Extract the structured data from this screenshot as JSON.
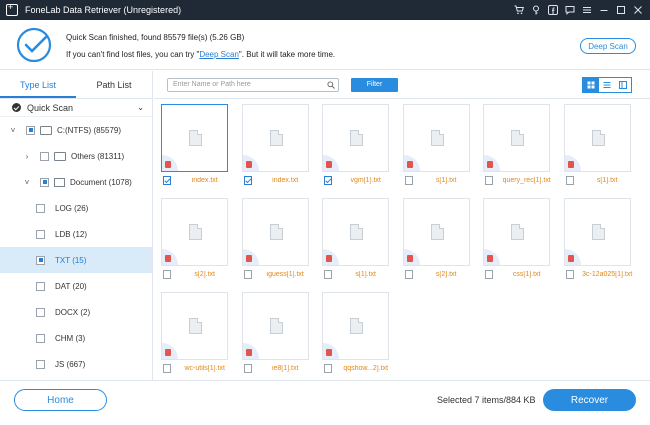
{
  "window": {
    "title": "FoneLab Data Retriever (Unregistered)",
    "icons": [
      "cart-icon",
      "key-icon",
      "facebook-icon",
      "chat-icon",
      "menu-icon",
      "minimize-icon",
      "maximize-icon",
      "close-icon"
    ]
  },
  "status": {
    "line1": "Quick Scan finished, found 85579 file(s) (5.26 GB)",
    "line2_pre": "If you can't find lost files, you can try \"",
    "line2_link": "Deep Scan",
    "line2_post": "\". But it will take more time.",
    "deep_scan_button": "Deep Scan"
  },
  "sidebar": {
    "tabs": [
      "Type List",
      "Path List"
    ],
    "active_tab": "Type List",
    "scan_mode": "Quick Scan",
    "tree": [
      {
        "label": "C:(NTFS) (85579)",
        "level": 0,
        "expander": "expanded",
        "check": "partial",
        "icon": "drive"
      },
      {
        "label": "Others (81311)",
        "level": 1,
        "expander": "collapsed",
        "check": "none",
        "icon": "folder"
      },
      {
        "label": "Document (1078)",
        "level": 1,
        "expander": "expanded",
        "check": "partial",
        "icon": "document"
      },
      {
        "label": "LOG (26)",
        "level": 2,
        "check": "none"
      },
      {
        "label": "LDB (12)",
        "level": 2,
        "check": "none"
      },
      {
        "label": "TXT (15)",
        "level": 2,
        "check": "partial",
        "selected": true
      },
      {
        "label": "DAT (20)",
        "level": 2,
        "check": "none"
      },
      {
        "label": "DOCX (2)",
        "level": 2,
        "check": "none"
      },
      {
        "label": "CHM (3)",
        "level": 2,
        "check": "none"
      },
      {
        "label": "JS (667)",
        "level": 2,
        "check": "none"
      }
    ]
  },
  "toolbar": {
    "search_placeholder": "Enter Name or Path here",
    "filter_label": "Filter",
    "views": [
      "grid-view",
      "list-view",
      "detail-view"
    ],
    "active_view": "grid-view"
  },
  "files": [
    {
      "name": "index.txt",
      "checked": true,
      "selected": true
    },
    {
      "name": "index.txt",
      "checked": true
    },
    {
      "name": "vgm[1].txt",
      "checked": true
    },
    {
      "name": "s[1].txt",
      "checked": false
    },
    {
      "name": "query_rec[1].txt",
      "checked": false
    },
    {
      "name": "s[1].txt",
      "checked": false
    },
    {
      "name": "s[2].txt",
      "checked": false
    },
    {
      "name": "iguess[1].txt",
      "checked": false
    },
    {
      "name": "s[1].txt",
      "checked": false
    },
    {
      "name": "s[2].txt",
      "checked": false
    },
    {
      "name": "css[1].txt",
      "checked": false
    },
    {
      "name": "3c-12a025[1].txt",
      "checked": false
    },
    {
      "name": "wc-utils[1].txt",
      "checked": false
    },
    {
      "name": "ie8[1].txt",
      "checked": false
    },
    {
      "name": "qqshow...2].txt",
      "checked": false
    }
  ],
  "bottom": {
    "home_label": "Home",
    "selected_info": "Selected 7 items/884 KB",
    "recover_label": "Recover"
  }
}
